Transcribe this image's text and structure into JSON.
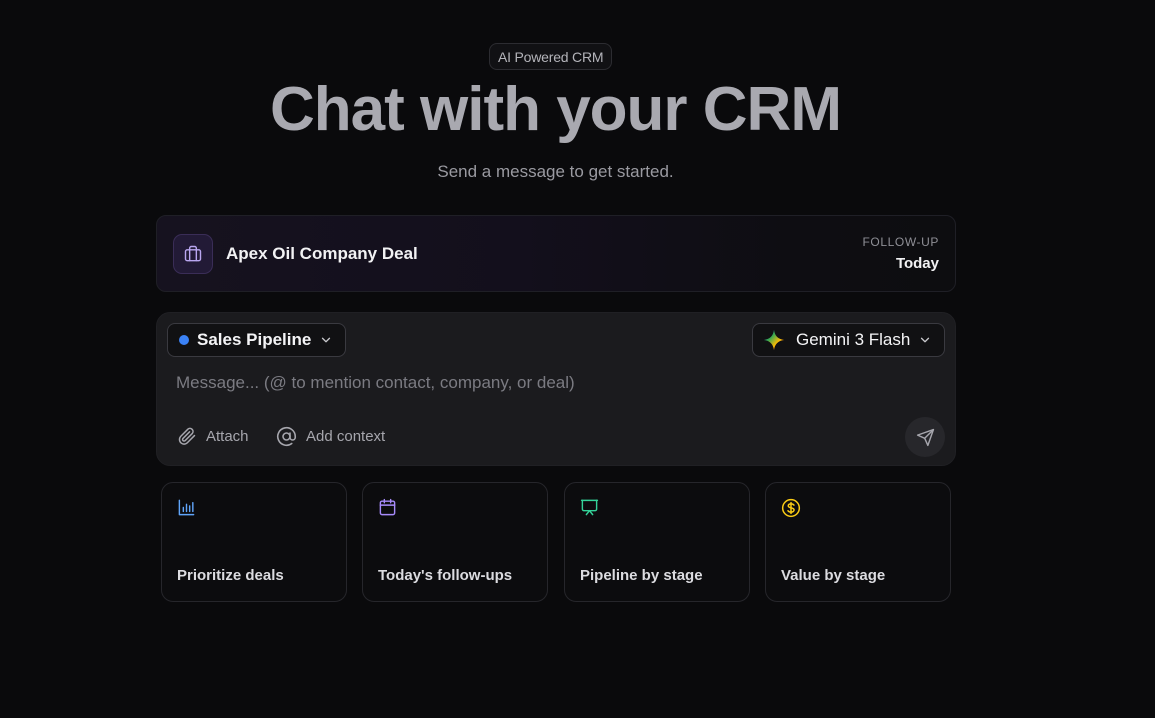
{
  "header": {
    "badge": "AI Powered CRM",
    "title": "Chat with your CRM",
    "subtitle": "Send a message to get started."
  },
  "deal_card": {
    "name": "Apex Oil Company Deal",
    "followup_label": "FOLLOW-UP",
    "followup_value": "Today",
    "icon": "briefcase-icon"
  },
  "composer": {
    "pipeline_label": "Sales Pipeline",
    "pipeline_dot_color": "#3b82f6",
    "model_label": "Gemini 3 Flash",
    "message_placeholder": "Message... (@ to mention contact, company, or deal)",
    "attach_label": "Attach",
    "add_context_label": "Add context"
  },
  "suggestions": [
    {
      "label": "Prioritize deals",
      "icon": "bar-chart-icon",
      "color": "#60a5fa"
    },
    {
      "label": "Today's follow-ups",
      "icon": "calendar-icon",
      "color": "#a78bfa"
    },
    {
      "label": "Pipeline by stage",
      "icon": "presentation-icon",
      "color": "#34d399"
    },
    {
      "label": "Value by stage",
      "icon": "dollar-coin-icon",
      "color": "#facc15"
    }
  ]
}
